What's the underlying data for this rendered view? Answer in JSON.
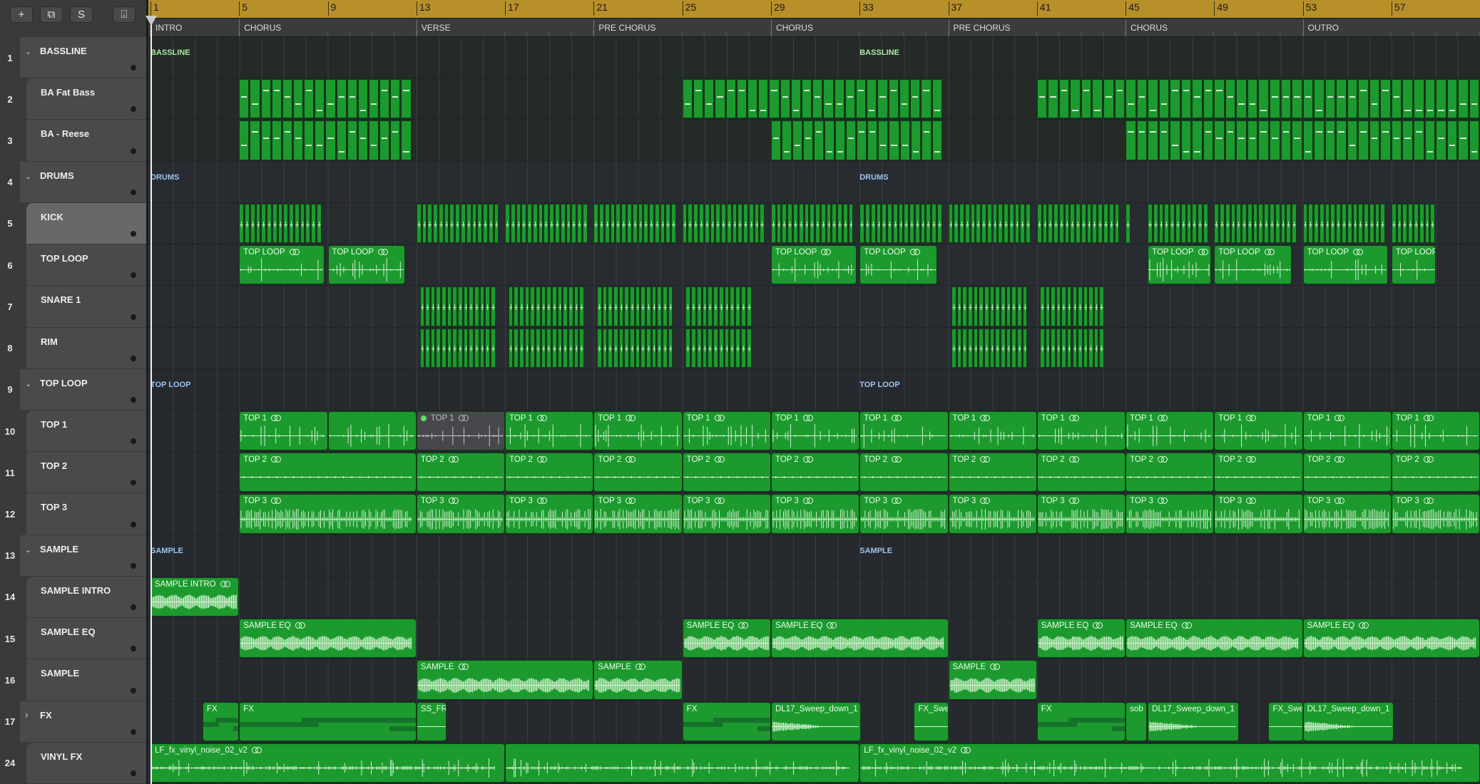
{
  "toolbar": {
    "buttons": [
      {
        "id": "add-track",
        "icon": "plus-icon",
        "glyph": "+"
      },
      {
        "id": "duplicate-track",
        "icon": "duplicate-icon",
        "glyph": "⧉"
      },
      {
        "id": "solo",
        "icon": "solo-icon",
        "glyph": "S"
      },
      {
        "id": "download",
        "icon": "download-icon",
        "glyph": "⍗"
      }
    ]
  },
  "ruler": {
    "bars": [
      "1",
      "5",
      "9",
      "13",
      "17",
      "21",
      "25",
      "29",
      "33",
      "37",
      "41",
      "45",
      "49",
      "53",
      "57"
    ]
  },
  "markers": [
    {
      "label": "INTRO",
      "bar": 1
    },
    {
      "label": "CHORUS",
      "bar": 5
    },
    {
      "label": "VERSE",
      "bar": 13
    },
    {
      "label": "PRE CHORUS",
      "bar": 21
    },
    {
      "label": "CHORUS",
      "bar": 29
    },
    {
      "label": "PRE CHORUS",
      "bar": 37
    },
    {
      "label": "CHORUS",
      "bar": 45
    },
    {
      "label": "OUTRO",
      "bar": 53
    }
  ],
  "colors": {
    "region": "#1c9a2e",
    "ruler": "#b8902a",
    "bass_folder_label": "#a9e9a4",
    "folder_label": "#9cc4ef",
    "muted": "#47484c"
  },
  "tracks": [
    {
      "number": "1",
      "name": "BASSLINE",
      "kind": "folder",
      "lane": "bass",
      "folder_label": "BASSLINE",
      "label_color": "#a9e9a4",
      "folder_label_bars": [
        1,
        33
      ],
      "regions": []
    },
    {
      "number": "2",
      "name": "BA Fat Bass",
      "kind": "child",
      "lane": "bass",
      "first": true,
      "regions": [
        {
          "type": "midi",
          "start": 5,
          "len": 7.8
        },
        {
          "type": "midi",
          "start": 25,
          "len": 11.75
        },
        {
          "type": "midi",
          "start": 41,
          "len": 20
        }
      ]
    },
    {
      "number": "3",
      "name": "BA - Reese",
      "kind": "child",
      "lane": "bass",
      "regions": [
        {
          "type": "midi",
          "start": 5,
          "len": 7.8
        },
        {
          "type": "midi",
          "start": 29,
          "len": 7.75
        },
        {
          "type": "midi",
          "start": 45,
          "len": 16
        }
      ]
    },
    {
      "number": "4",
      "name": "DRUMS",
      "kind": "folder",
      "lane": "drums",
      "folder_label": "DRUMS",
      "label_color": "#9cc4ef",
      "folder_label_bars": [
        1,
        33
      ],
      "regions": []
    },
    {
      "number": "5",
      "name": "KICK",
      "kind": "child",
      "lane": "drums",
      "first": true,
      "selected": true,
      "regions": [
        {
          "type": "drum",
          "start": 5,
          "len": 3.75
        },
        {
          "type": "drum",
          "start": 13,
          "len": 3.75
        },
        {
          "type": "drum",
          "start": 17,
          "len": 3.75
        },
        {
          "type": "drum",
          "start": 21,
          "len": 3.75
        },
        {
          "type": "drum",
          "start": 25,
          "len": 3.75
        },
        {
          "type": "drum",
          "start": 29,
          "len": 3.75
        },
        {
          "type": "drum",
          "start": 33,
          "len": 3.75
        },
        {
          "type": "drum",
          "start": 37,
          "len": 3.75
        },
        {
          "type": "drum",
          "start": 41,
          "len": 3.75
        },
        {
          "type": "drum",
          "start": 45,
          "len": 0.25
        },
        {
          "type": "drum",
          "start": 46,
          "len": 2.75
        },
        {
          "type": "drum",
          "start": 49,
          "len": 3.75
        },
        {
          "type": "drum",
          "start": 53,
          "len": 3.75
        },
        {
          "type": "drum",
          "start": 57,
          "len": 2
        }
      ]
    },
    {
      "number": "6",
      "name": "TOP LOOP",
      "kind": "child",
      "lane": "drums",
      "regions": [
        {
          "type": "audio",
          "wave": "spiky",
          "label": "TOP LOOP",
          "loop": true,
          "start": 5,
          "len": 3.85
        },
        {
          "type": "audio",
          "wave": "spiky",
          "label": "TOP LOOP",
          "loop": true,
          "start": 9,
          "len": 3.5
        },
        {
          "type": "audio",
          "wave": "spiky",
          "label": "TOP LOOP",
          "loop": true,
          "start": 29,
          "len": 3.85
        },
        {
          "type": "audio",
          "wave": "spiky",
          "label": "TOP LOOP",
          "loop": true,
          "start": 33,
          "len": 3.5
        },
        {
          "type": "audio",
          "wave": "spiky",
          "label": "TOP LOOP",
          "loop": true,
          "start": 46,
          "len": 2.85
        },
        {
          "type": "audio",
          "wave": "spiky",
          "label": "TOP LOOP",
          "loop": true,
          "start": 49,
          "len": 3.5
        },
        {
          "type": "audio",
          "wave": "spiky",
          "label": "TOP LOOP",
          "loop": true,
          "start": 53,
          "len": 3.85
        },
        {
          "type": "audio",
          "wave": "spiky",
          "label": "TOP LOOP",
          "loop": false,
          "start": 57,
          "len": 2
        }
      ]
    },
    {
      "number": "7",
      "name": "SNARE 1",
      "kind": "child",
      "lane": "drums",
      "regions": [
        {
          "type": "drum",
          "start": 13.15,
          "len": 3.45
        },
        {
          "type": "drum",
          "start": 17.15,
          "len": 3.45
        },
        {
          "type": "drum",
          "start": 21.15,
          "len": 3.45
        },
        {
          "type": "drum",
          "start": 25.15,
          "len": 3
        },
        {
          "type": "drum",
          "start": 37.15,
          "len": 3.45
        },
        {
          "type": "drum",
          "start": 41.15,
          "len": 2.9
        }
      ]
    },
    {
      "number": "8",
      "name": "RIM",
      "kind": "child",
      "lane": "drums",
      "regions": [
        {
          "type": "drum",
          "start": 13.15,
          "len": 3.45
        },
        {
          "type": "drum",
          "start": 17.15,
          "len": 3.45
        },
        {
          "type": "drum",
          "start": 21.15,
          "len": 3.45
        },
        {
          "type": "drum",
          "start": 25.15,
          "len": 3
        },
        {
          "type": "drum",
          "start": 37.15,
          "len": 3.45
        },
        {
          "type": "drum",
          "start": 41.15,
          "len": 2.9
        }
      ]
    },
    {
      "number": "9",
      "name": "TOP LOOP",
      "kind": "folder",
      "lane": "other",
      "folder_label": "TOP LOOP",
      "label_color": "#9cc4ef",
      "folder_label_bars": [
        1,
        33
      ],
      "regions": []
    },
    {
      "number": "10",
      "name": "TOP 1",
      "kind": "child",
      "lane": "other",
      "first": true,
      "regions": [
        {
          "type": "audio",
          "wave": "spiky",
          "label": "TOP 1",
          "loop": true,
          "start": 5,
          "len": 4
        },
        {
          "type": "audio",
          "wave": "spiky",
          "label": "",
          "loop": false,
          "start": 9,
          "len": 4
        },
        {
          "type": "audio",
          "wave": "spiky",
          "label": "TOP 1",
          "loop": true,
          "muted": true,
          "start": 13,
          "len": 4
        },
        {
          "type": "audio",
          "wave": "spiky",
          "label": "TOP 1",
          "loop": true,
          "start": 17,
          "len": 4
        },
        {
          "type": "audio",
          "wave": "spiky",
          "label": "TOP 1",
          "loop": true,
          "start": 21,
          "len": 4
        },
        {
          "type": "audio",
          "wave": "spiky",
          "label": "TOP 1",
          "loop": true,
          "start": 25,
          "len": 4
        },
        {
          "type": "audio",
          "wave": "spiky",
          "label": "TOP 1",
          "loop": true,
          "start": 29,
          "len": 4
        },
        {
          "type": "audio",
          "wave": "spiky",
          "label": "TOP 1",
          "loop": true,
          "start": 33,
          "len": 4
        },
        {
          "type": "audio",
          "wave": "spiky",
          "label": "TOP 1",
          "loop": true,
          "start": 37,
          "len": 4
        },
        {
          "type": "audio",
          "wave": "spiky",
          "label": "TOP 1",
          "loop": true,
          "start": 41,
          "len": 4
        },
        {
          "type": "audio",
          "wave": "spiky",
          "label": "TOP 1",
          "loop": true,
          "start": 45,
          "len": 4
        },
        {
          "type": "audio",
          "wave": "spiky",
          "label": "TOP 1",
          "loop": true,
          "start": 49,
          "len": 4
        },
        {
          "type": "audio",
          "wave": "spiky",
          "label": "TOP 1",
          "loop": true,
          "start": 53,
          "len": 4
        },
        {
          "type": "audio",
          "wave": "spiky",
          "label": "TOP 1",
          "loop": true,
          "start": 57,
          "len": 4
        }
      ]
    },
    {
      "number": "11",
      "name": "TOP 2",
      "kind": "child",
      "lane": "other",
      "regions": [
        {
          "type": "audio",
          "wave": "flat",
          "label": "TOP 2",
          "loop": true,
          "start": 5,
          "len": 8
        },
        {
          "type": "audio",
          "wave": "flat",
          "label": "TOP 2",
          "loop": true,
          "start": 13,
          "len": 4
        },
        {
          "type": "audio",
          "wave": "flat",
          "label": "TOP 2",
          "loop": true,
          "start": 17,
          "len": 4
        },
        {
          "type": "audio",
          "wave": "flat",
          "label": "TOP 2",
          "loop": true,
          "start": 21,
          "len": 4
        },
        {
          "type": "audio",
          "wave": "flat",
          "label": "TOP 2",
          "loop": true,
          "start": 25,
          "len": 4
        },
        {
          "type": "audio",
          "wave": "flat",
          "label": "TOP 2",
          "loop": true,
          "start": 29,
          "len": 4
        },
        {
          "type": "audio",
          "wave": "flat",
          "label": "TOP 2",
          "loop": true,
          "start": 33,
          "len": 4
        },
        {
          "type": "audio",
          "wave": "flat",
          "label": "TOP 2",
          "loop": true,
          "start": 37,
          "len": 4
        },
        {
          "type": "audio",
          "wave": "flat",
          "label": "TOP 2",
          "loop": true,
          "start": 41,
          "len": 4
        },
        {
          "type": "audio",
          "wave": "flat",
          "label": "TOP 2",
          "loop": true,
          "start": 45,
          "len": 4
        },
        {
          "type": "audio",
          "wave": "flat",
          "label": "TOP 2",
          "loop": true,
          "start": 49,
          "len": 4
        },
        {
          "type": "audio",
          "wave": "flat",
          "label": "TOP 2",
          "loop": true,
          "start": 53,
          "len": 4
        },
        {
          "type": "audio",
          "wave": "flat",
          "label": "TOP 2",
          "loop": true,
          "start": 57,
          "len": 4
        }
      ]
    },
    {
      "number": "12",
      "name": "TOP 3",
      "kind": "child",
      "lane": "other",
      "regions": [
        {
          "type": "audio",
          "wave": "dense",
          "label": "TOP 3",
          "loop": true,
          "start": 5,
          "len": 8
        },
        {
          "type": "audio",
          "wave": "dense",
          "label": "TOP 3",
          "loop": true,
          "start": 13,
          "len": 4
        },
        {
          "type": "audio",
          "wave": "dense",
          "label": "TOP 3",
          "loop": true,
          "start": 17,
          "len": 4
        },
        {
          "type": "audio",
          "wave": "dense",
          "label": "TOP 3",
          "loop": true,
          "start": 21,
          "len": 4
        },
        {
          "type": "audio",
          "wave": "dense",
          "label": "TOP 3",
          "loop": true,
          "start": 25,
          "len": 4
        },
        {
          "type": "audio",
          "wave": "dense",
          "label": "TOP 3",
          "loop": true,
          "start": 29,
          "len": 4
        },
        {
          "type": "audio",
          "wave": "dense",
          "label": "TOP 3",
          "loop": true,
          "start": 33,
          "len": 4
        },
        {
          "type": "audio",
          "wave": "dense",
          "label": "TOP 3",
          "loop": true,
          "start": 37,
          "len": 4
        },
        {
          "type": "audio",
          "wave": "dense",
          "label": "TOP 3",
          "loop": true,
          "start": 41,
          "len": 4
        },
        {
          "type": "audio",
          "wave": "dense",
          "label": "TOP 3",
          "loop": true,
          "start": 45,
          "len": 4
        },
        {
          "type": "audio",
          "wave": "dense",
          "label": "TOP 3",
          "loop": true,
          "start": 49,
          "len": 4
        },
        {
          "type": "audio",
          "wave": "dense",
          "label": "TOP 3",
          "loop": true,
          "start": 53,
          "len": 4
        },
        {
          "type": "audio",
          "wave": "dense",
          "label": "TOP 3",
          "loop": true,
          "start": 57,
          "len": 4
        }
      ]
    },
    {
      "number": "13",
      "name": "SAMPLE",
      "kind": "folder",
      "lane": "other",
      "folder_label": "SAMPLE",
      "label_color": "#9cc4ef",
      "folder_label_bars": [
        1,
        33
      ],
      "regions": []
    },
    {
      "number": "14",
      "name": "SAMPLE INTRO",
      "kind": "child",
      "lane": "other",
      "first": true,
      "regions": [
        {
          "type": "audio",
          "wave": "blob",
          "label": "SAMPLE INTRO",
          "loop": true,
          "start": 1,
          "len": 4
        }
      ]
    },
    {
      "number": "15",
      "name": "SAMPLE EQ",
      "kind": "child",
      "lane": "other",
      "regions": [
        {
          "type": "audio",
          "wave": "blob",
          "label": "SAMPLE EQ",
          "loop": true,
          "start": 5,
          "len": 8
        },
        {
          "type": "audio",
          "wave": "blob",
          "label": "SAMPLE EQ",
          "loop": true,
          "start": 25,
          "len": 4
        },
        {
          "type": "audio",
          "wave": "blob",
          "label": "SAMPLE EQ",
          "loop": true,
          "start": 29,
          "len": 8
        },
        {
          "type": "audio",
          "wave": "blob",
          "label": "SAMPLE EQ",
          "loop": true,
          "start": 41,
          "len": 4
        },
        {
          "type": "audio",
          "wave": "blob",
          "label": "SAMPLE EQ",
          "loop": true,
          "start": 45,
          "len": 8
        },
        {
          "type": "audio",
          "wave": "blob",
          "label": "SAMPLE EQ",
          "loop": true,
          "start": 53,
          "len": 8
        }
      ]
    },
    {
      "number": "16",
      "name": "SAMPLE",
      "kind": "child",
      "lane": "other",
      "regions": [
        {
          "type": "audio",
          "wave": "blob",
          "label": "SAMPLE",
          "loop": true,
          "start": 13,
          "len": 8
        },
        {
          "type": "audio",
          "wave": "blob",
          "label": "SAMPLE",
          "loop": true,
          "start": 21,
          "len": 4
        },
        {
          "type": "audio",
          "wave": "blob",
          "label": "SAMPLE",
          "loop": true,
          "start": 37,
          "len": 4
        }
      ]
    },
    {
      "number": "17",
      "name": "FX",
      "kind": "folder-closed",
      "lane": "other",
      "regions": [
        {
          "type": "audio",
          "wave": "auto",
          "label": "FX",
          "start": 3.35,
          "len": 1.65
        },
        {
          "type": "audio",
          "wave": "auto",
          "label": "FX",
          "start": 5,
          "len": 8
        },
        {
          "type": "audio",
          "wave": "line",
          "label": "SS_FR",
          "start": 13,
          "len": 1.35
        },
        {
          "type": "audio",
          "wave": "auto",
          "label": "FX",
          "start": 25,
          "len": 4
        },
        {
          "type": "audio",
          "wave": "sweep",
          "label": "DL17_Sweep_down_1",
          "start": 29,
          "len": 4.05
        },
        {
          "type": "audio",
          "wave": "line",
          "label": "FX_Swe",
          "start": 35.45,
          "len": 1.55
        },
        {
          "type": "audio",
          "wave": "auto",
          "label": "FX",
          "start": 41,
          "len": 4
        },
        {
          "type": "audio",
          "wave": "burst",
          "label": "sob",
          "start": 45,
          "len": 0.95
        },
        {
          "type": "audio",
          "wave": "sweep",
          "label": "DL17_Sweep_down_1",
          "start": 46,
          "len": 4.1
        },
        {
          "type": "audio",
          "wave": "line",
          "label": "FX_Swe",
          "start": 51.45,
          "len": 1.55
        },
        {
          "type": "audio",
          "wave": "sweep",
          "label": "DL17_Sweep_down_1",
          "start": 53,
          "len": 4.1
        }
      ]
    },
    {
      "number": "24",
      "name": "VINYL FX",
      "kind": "child",
      "lane": "other",
      "first": true,
      "regions": [
        {
          "type": "audio",
          "wave": "noise",
          "label": "LF_fx_vinyl_noise_02_v2",
          "loop": true,
          "start": 1,
          "len": 16
        },
        {
          "type": "audio",
          "wave": "noise",
          "label": "",
          "loop": false,
          "start": 17,
          "len": 16
        },
        {
          "type": "audio",
          "wave": "noise",
          "label": "LF_fx_vinyl_noise_02_v2",
          "loop": true,
          "start": 33,
          "len": 28
        }
      ]
    }
  ]
}
